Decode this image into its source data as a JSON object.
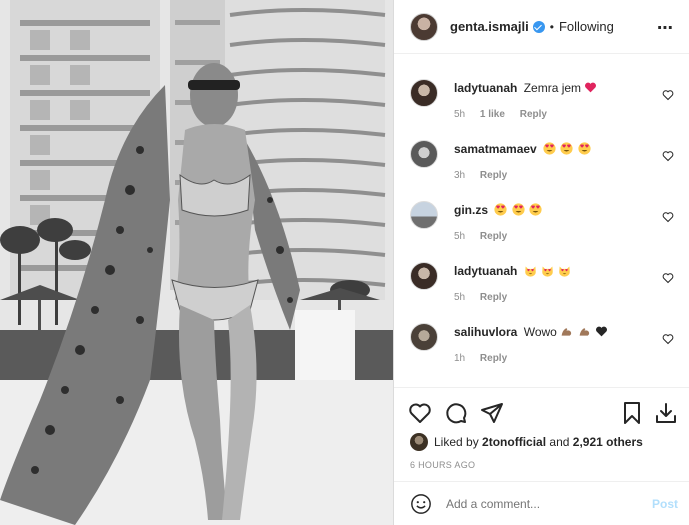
{
  "post": {
    "username": "genta.ismajli",
    "dot": "•",
    "follow_status": "Following",
    "more_glyph": "⋯"
  },
  "comments": [
    {
      "user": "ladytuanah",
      "text": "Zemra jem",
      "emojis": [
        "red-heart"
      ],
      "time": "5h",
      "likes": "1 like",
      "reply": "Reply"
    },
    {
      "user": "samatmamaev",
      "text": "",
      "emojis": [
        "heart-eyes",
        "heart-eyes",
        "heart-eyes"
      ],
      "time": "3h",
      "likes": "",
      "reply": "Reply"
    },
    {
      "user": "gin.zs",
      "text": "",
      "emojis": [
        "heart-eyes",
        "heart-eyes",
        "heart-eyes"
      ],
      "time": "5h",
      "likes": "",
      "reply": "Reply"
    },
    {
      "user": "ladytuanah",
      "text": "",
      "emojis": [
        "heart-eyes-cat",
        "heart-eyes-cat",
        "heart-eyes-cat"
      ],
      "time": "5h",
      "likes": "",
      "reply": "Reply"
    },
    {
      "user": "salihuvlora",
      "text": "Wowo",
      "emojis": [
        "flexed-biceps",
        "flexed-biceps",
        "black-heart"
      ],
      "time": "1h",
      "likes": "",
      "reply": "Reply"
    }
  ],
  "likes": {
    "prefix": "Liked by",
    "user": "2tonofficial",
    "and": "and",
    "count": "2,921 others"
  },
  "timestamp": "6 HOURS AGO",
  "comment_box": {
    "placeholder": "Add a comment...",
    "post_label": "Post"
  },
  "colors": {
    "verified": "#3897f0",
    "post_disabled": "#b2dffc",
    "meta_gray": "#8e8e8e",
    "heart_red": "#ed4956"
  },
  "icons": [
    "verified-badge-icon",
    "more-options-icon",
    "heart-outline-icon",
    "comment-icon",
    "share-icon",
    "bookmark-icon",
    "download-icon",
    "smiley-icon"
  ]
}
